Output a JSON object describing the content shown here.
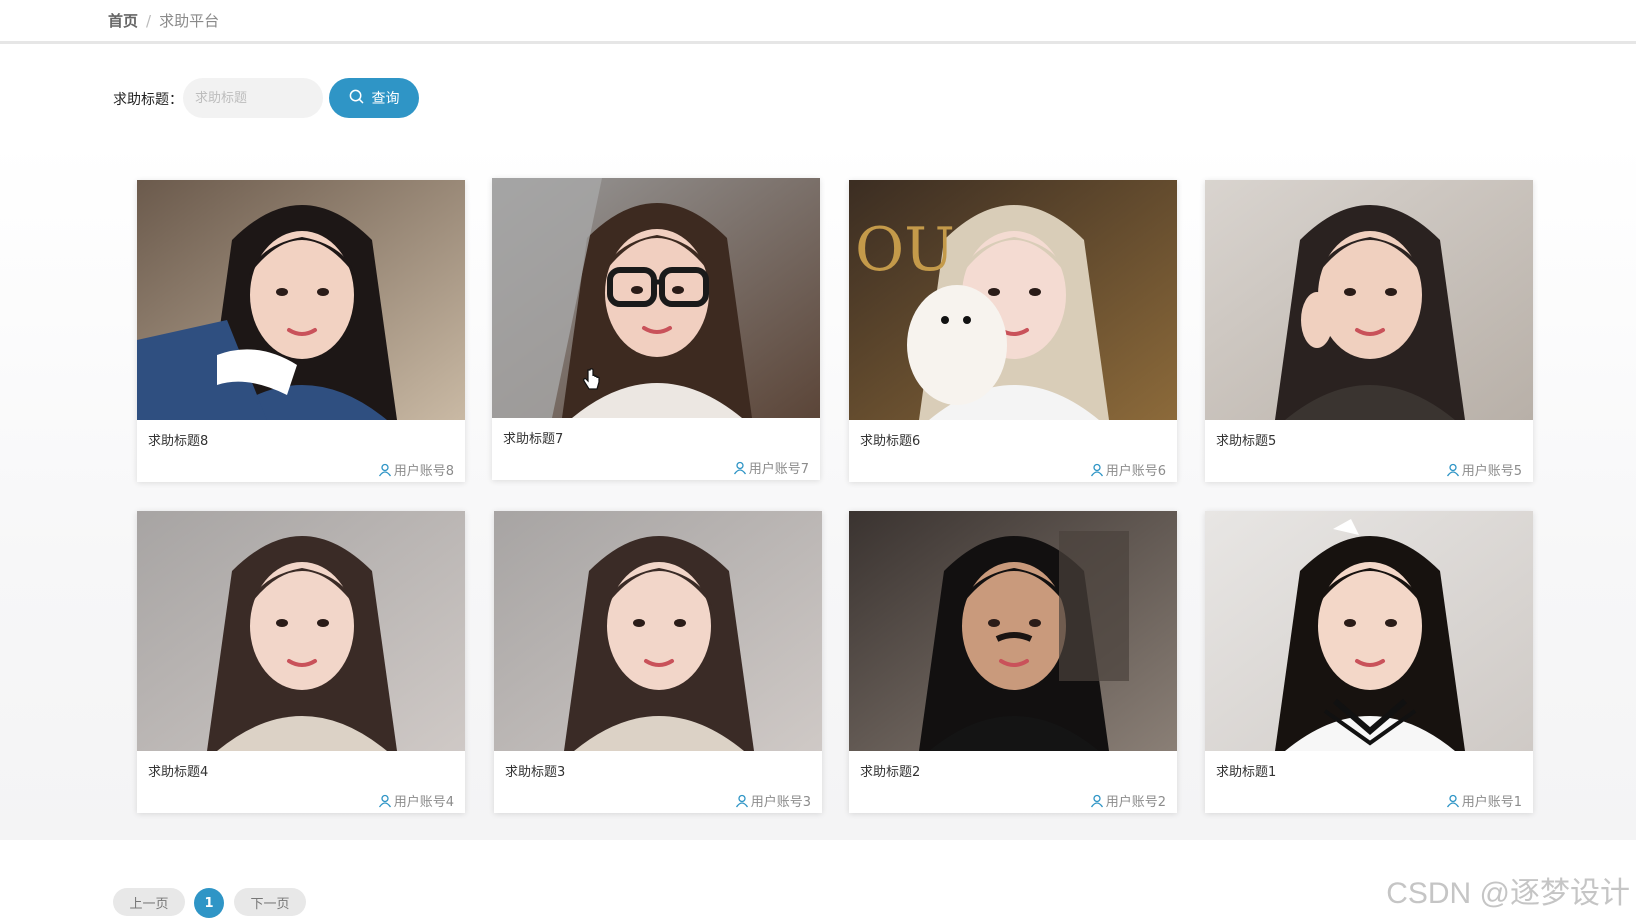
{
  "breadcrumb": {
    "home": "首页",
    "separator": "/",
    "current": "求助平台"
  },
  "search": {
    "label": "求助标题：",
    "placeholder": "求助标题",
    "value": "",
    "button_label": "查询"
  },
  "cards": [
    {
      "title": "求助标题8",
      "author": "用户账号8",
      "photo": "girl-long-hair-leaning-on-arm"
    },
    {
      "title": "求助标题7",
      "author": "用户账号7",
      "photo": "girl-black-glasses"
    },
    {
      "title": "求助标题6",
      "author": "用户账号6",
      "photo": "girl-with-white-dog"
    },
    {
      "title": "求助标题5",
      "author": "用户账号5",
      "photo": "girl-winking"
    },
    {
      "title": "求助标题4",
      "author": "用户账号4",
      "photo": "girl-beige-sweater"
    },
    {
      "title": "求助标题3",
      "author": "用户账号3",
      "photo": "girl-beige-sweater"
    },
    {
      "title": "求助标题2",
      "author": "用户账号2",
      "photo": "man-black-turtleneck"
    },
    {
      "title": "求助标题1",
      "author": "用户账号1",
      "photo": "girl-sailor-uniform"
    }
  ],
  "pagination": {
    "prev_label": "上一页",
    "current_page": "1",
    "next_label": "下一页"
  },
  "watermark": "CSDN @逐梦设计",
  "colors": {
    "accent": "#2f95c6",
    "card_bg": "#ffffff",
    "page_bg": "#ffffff"
  }
}
